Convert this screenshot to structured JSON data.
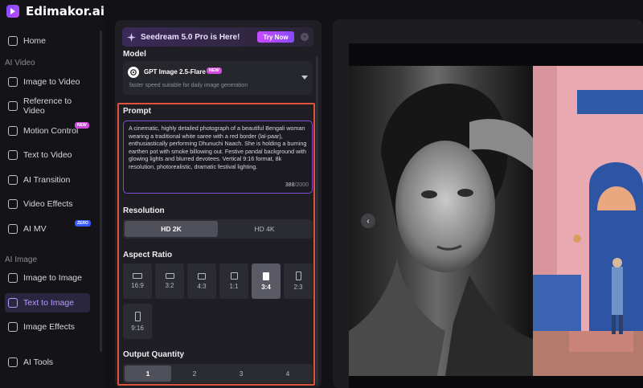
{
  "brand": {
    "name": "Edimakor.ai"
  },
  "sidebar": {
    "home": "Home",
    "section_video": "AI Video",
    "video_items": [
      {
        "label": "Image to Video"
      },
      {
        "label": "Reference to Video"
      },
      {
        "label": "Motion Control",
        "badge": "NEW"
      },
      {
        "label": "Text to Video"
      },
      {
        "label": "AI Transition"
      },
      {
        "label": "Video Effects"
      },
      {
        "label": "AI MV",
        "badge": "ZERO"
      }
    ],
    "section_image": "AI Image",
    "image_items": [
      {
        "label": "Image to Image"
      },
      {
        "label": "Text to Image"
      },
      {
        "label": "Image Effects"
      }
    ],
    "tools": "AI Tools"
  },
  "promo": {
    "text": "Seedream 5.0 Pro is Here!",
    "button": "Try Now",
    "close": "×"
  },
  "model": {
    "label": "Model",
    "name": "GPT Image 2.5-Flare",
    "badge": "NEW",
    "description": "faster speed suitable for daily image generation"
  },
  "prompt": {
    "label": "Prompt",
    "text": "A cinematic, highly detailed photograph of a beautiful Bengali woman wearing a traditional white saree with a red border (lal-paar), enthusiastically performing Dhunuchi Naach. She is holding a burning earthen pot with smoke billowing out. Festive pandal background with glowing lights and blurred devotees. Vertical 9:16 format, 8k resolution, photorealistic, dramatic festival lighting.",
    "count": "388",
    "max": "/2000"
  },
  "resolution": {
    "label": "Resolution",
    "options": [
      "HD 2K",
      "HD 4K"
    ],
    "selected": "HD 2K"
  },
  "aspect": {
    "label": "Aspect Ratio",
    "options": [
      "16:9",
      "3:2",
      "4:3",
      "1:1",
      "3:4",
      "2:3",
      "9:16"
    ],
    "selected": "3:4"
  },
  "quantity": {
    "label": "Output Quantity",
    "options": [
      "1",
      "2",
      "3",
      "4"
    ],
    "selected": "1"
  },
  "preview": {
    "prev_arrow": "‹"
  },
  "colors": {
    "accent": "#8a4bff",
    "highlight": "#e0523a",
    "active_nav": "#b79cff"
  }
}
